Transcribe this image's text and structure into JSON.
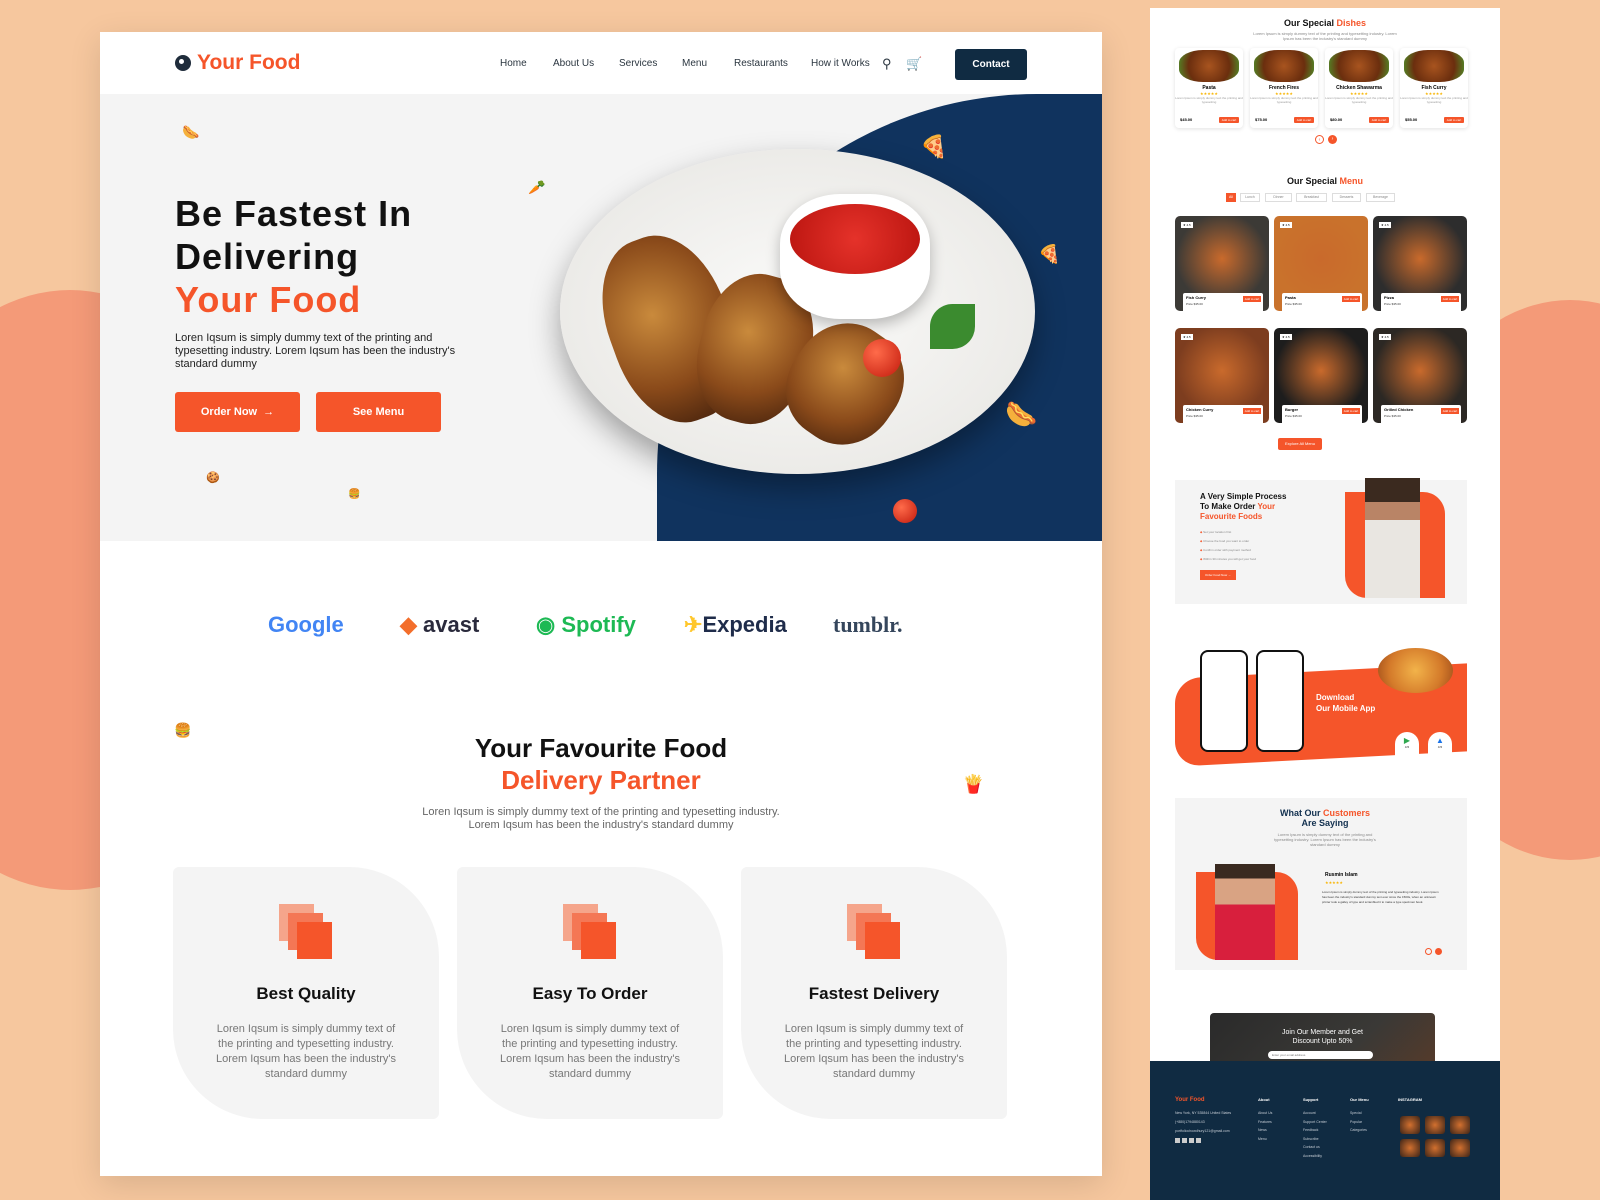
{
  "brand": {
    "name": "Your Food",
    "accent": "#f5552a",
    "navy": "#102b42"
  },
  "nav": {
    "links": [
      "Home",
      "About Us",
      "Services",
      "Menu",
      "Restaurants",
      "How it Works"
    ],
    "contact": "Contact",
    "icons": [
      "search-icon",
      "cart-icon"
    ]
  },
  "hero": {
    "line1": "Be Fastest In",
    "line2": "Delivering",
    "line3": "Your Food",
    "text": "Loren Iqsum is simply dummy text of the printing and typesetting industry. Lorem Iqsum has been the industry's standard dummy",
    "order_btn": "Order Now",
    "order_arrow": "→",
    "menu_btn": "See Menu"
  },
  "partners": [
    "Google",
    "avast",
    "Spotify",
    "Expedia",
    "tumblr."
  ],
  "features": {
    "title1": "Your Favourite Food",
    "title2": "Delivery Partner",
    "text1": "Loren Iqsum is simply dummy text of the printing and typesetting industry.",
    "text2": "Lorem Iqsum has been the industry's standard dummy",
    "cards": [
      {
        "title": "Best Quality",
        "text": "Loren Iqsum is simply dummy text of the printing and typesetting industry. Lorem Iqsum has been the industry's standard dummy"
      },
      {
        "title": "Easy To Order",
        "text": "Loren Iqsum is simply dummy text of the printing and typesetting industry. Lorem Iqsum has been the industry's standard dummy"
      },
      {
        "title": "Fastest Delivery",
        "text": "Loren Iqsum is simply dummy text of the printing and typesetting industry. Lorem Iqsum has been the industry's standard dummy"
      }
    ]
  },
  "side": {
    "dishes": {
      "title1": "Our Special",
      "title2": "Dishes",
      "sub": "Lorem Ipsum is simply dummy text of the printing and typesetting industry. Lorem Ipsum has been the industry's standard dummy",
      "items": [
        {
          "name": "Pasta",
          "price": "$45.00",
          "stars": "★★★★★",
          "desc": "Lorem Ipsum is simply dummy text the printing and typesetting",
          "btn": "Add to cart"
        },
        {
          "name": "French Fires",
          "price": "$75.00",
          "stars": "★★★★★",
          "desc": "Lorem Ipsum is simply dummy text the printing and typesetting",
          "btn": "Add to cart"
        },
        {
          "name": "Chicken Shawarma",
          "price": "$80.00",
          "stars": "★★★★★",
          "desc": "Lorem Ipsum is simply dummy text the printing and typesetting",
          "btn": "Add to cart"
        },
        {
          "name": "Fish Curry",
          "price": "$55.00",
          "stars": "★★★★★",
          "desc": "Lorem Ipsum is simply dummy text the printing and typesetting",
          "btn": "Add to cart"
        }
      ],
      "prev": "‹",
      "next": "›"
    },
    "menu": {
      "title1": "Our Special",
      "title2": "Menu",
      "tabs": [
        "All",
        "Lunch",
        "Dinner",
        "Breakfast",
        "Desserts",
        "Beverage"
      ],
      "items": [
        {
          "name": "Fish Curry",
          "price": "Price  $35.00",
          "rating": "★ 4.5",
          "btn": "Add to cart",
          "color": "#3c3a36"
        },
        {
          "name": "Pasta",
          "price": "Price  $35.00",
          "rating": "★ 4.5",
          "btn": "Add to cart",
          "color": "#c9722c"
        },
        {
          "name": "Pizza",
          "price": "Price  $35.00",
          "rating": "★ 4.5",
          "btn": "Add to cart",
          "color": "#2d2d2d"
        },
        {
          "name": "Chicken Curry",
          "price": "Price  $35.00",
          "rating": "★ 4.5",
          "btn": "Add to cart",
          "color": "#7d3d1f"
        },
        {
          "name": "Burger",
          "price": "Price  $35.00",
          "rating": "★ 4.5",
          "btn": "Add to cart",
          "color": "#1d1d1d"
        },
        {
          "name": "Grilled Chicken",
          "price": "Price  $35.00",
          "rating": "★ 4.5",
          "btn": "Add to cart",
          "color": "#2c2824"
        }
      ],
      "explore": "Explore All Menu"
    },
    "process": {
      "title1": "A Very Simple Process",
      "title2": "To Make Order",
      "title3": "Your",
      "title4": "Favourite Foods",
      "steps": [
        "Set your location first",
        "Choose the food you want to order",
        "Confirm order with payment method",
        "Within 30 minutes you will get your food"
      ],
      "btn": "Order Food Now →"
    },
    "app": {
      "title1": "Download",
      "title2": "Our Mobile App",
      "stores": [
        "Google Play",
        "App Store"
      ],
      "ratings": [
        "4.5",
        "4.5"
      ]
    },
    "testimonials": {
      "title1": "What Our",
      "title2": "Customers",
      "title3": "Are Saying",
      "sub": "Lorem Ipsum is simply dummy text of the printing and typesetting industry. Lorem Ipsum has been the industry's standard dummy",
      "name": "Rusmin Islam",
      "stars": "★★★★★",
      "quote": "Lorem Ipsum is simply dummy text of the printing and typesetting industry. Lorem Ipsum has been the industry's standard dummy text ever since the 1500s, when an unknown printer took a galley of type and scrambled it to make a type specimen book."
    },
    "newsletter": {
      "title1": "Join Our Member and Get",
      "title2": "Discount Upto 50%",
      "placeholder": "Enter your email address"
    },
    "footer": {
      "brand": "Your Food",
      "address": "New York, NY 535844 United States",
      "phone": "(+880)1794880143",
      "email": "portfoliochowdhury121@gmail.com",
      "cols": [
        {
          "title": "About",
          "links": [
            "About Us",
            "Features",
            "News",
            "Menu"
          ]
        },
        {
          "title": "Support",
          "links": [
            "Account",
            "Support Center",
            "Feedback",
            "Subscribe",
            "Contact us",
            "Accessibility"
          ]
        },
        {
          "title": "Our Menu",
          "links": [
            "Special",
            "Popular",
            "Categories"
          ]
        },
        {
          "title": "INSTAGRAM",
          "links": []
        }
      ]
    }
  }
}
